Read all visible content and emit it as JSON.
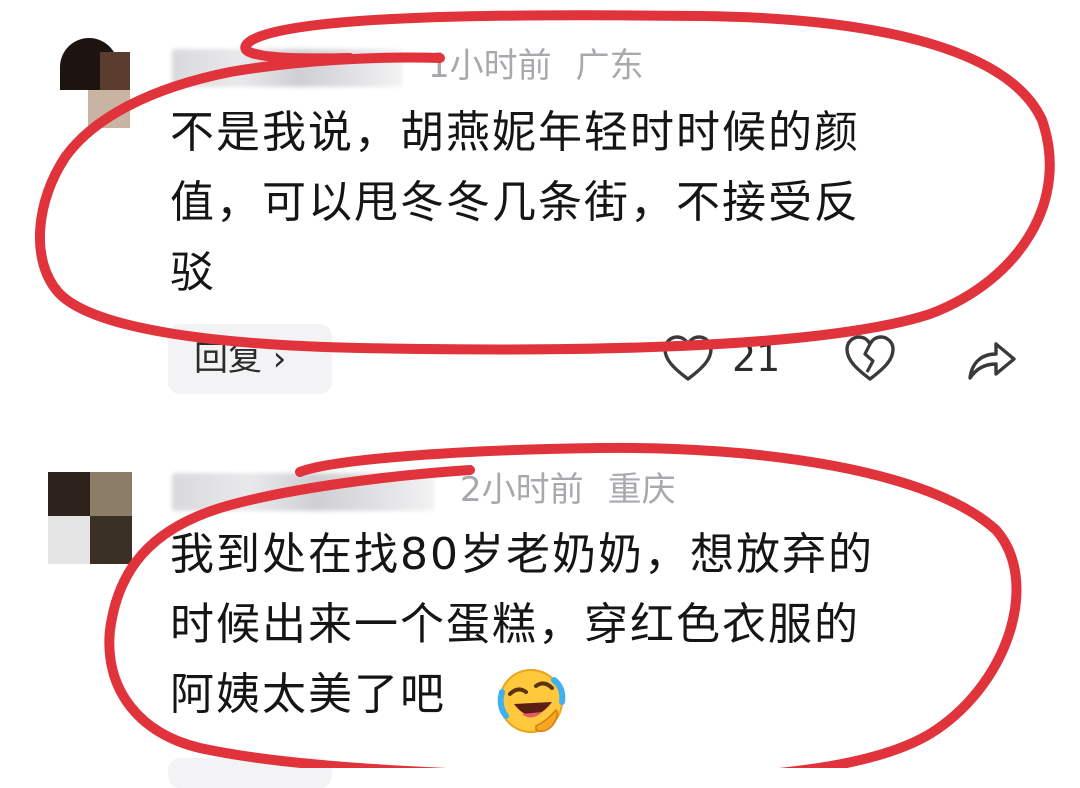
{
  "comments": [
    {
      "time": "1小时前",
      "location": "广东",
      "lines": [
        "不是我说，胡燕妮年轻时时候的颜",
        "值，可以甩冬冬几条街，不接受反",
        "驳"
      ],
      "reply_label": "回复 ›",
      "likes": "21"
    },
    {
      "time": "2小时前",
      "location": "重庆",
      "lines": [
        "我到处在找80岁老奶奶，想放弃的",
        "时候出来一个蛋糕，穿红色衣服的",
        "阿姨太美了吧"
      ],
      "emoji": "rolling-on-floor-laughing-emoji"
    }
  ],
  "colors": {
    "annotation_red": "#e0333b",
    "meta_gray": "#a9a9ad",
    "text": "#151515",
    "reply_bg": "#f3f3f5"
  },
  "icons": {
    "like": "heart-outline-icon",
    "dislike": "broken-heart-icon",
    "share": "share-arrow-icon"
  }
}
